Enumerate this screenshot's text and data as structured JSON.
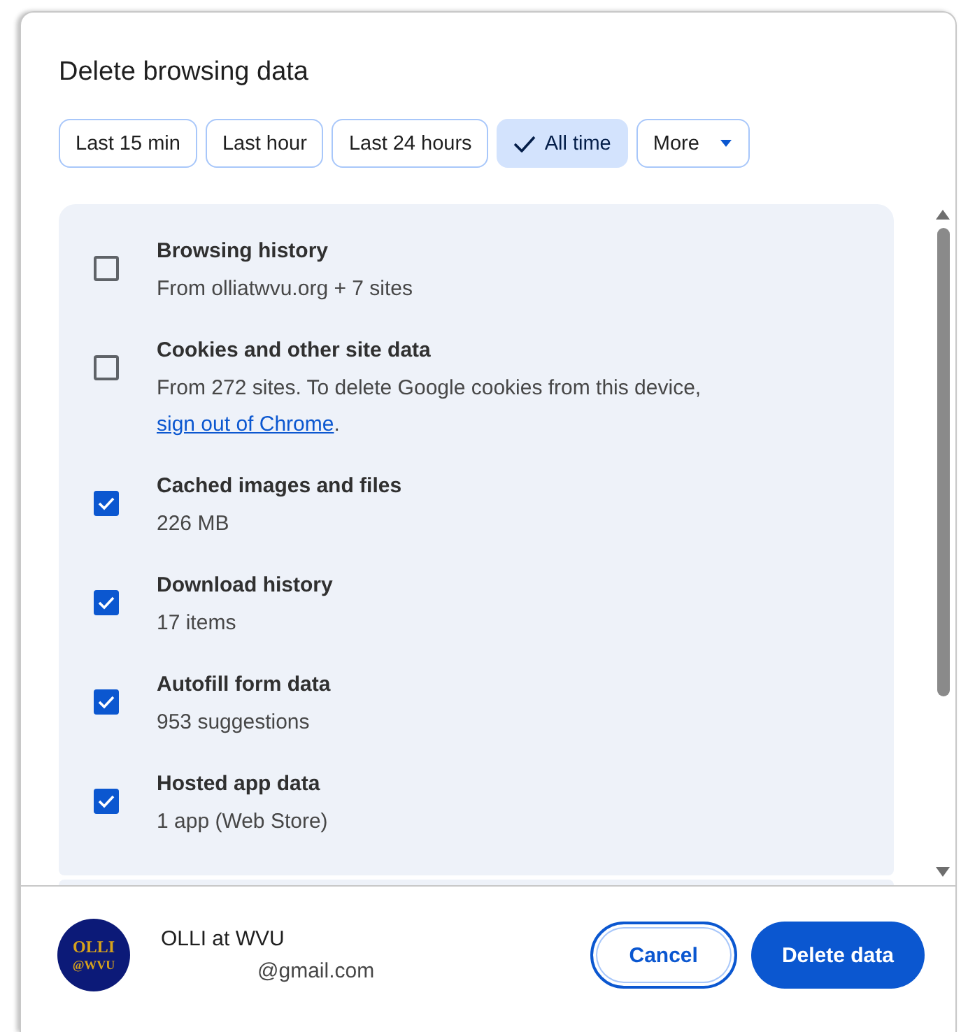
{
  "dialog": {
    "title": "Delete browsing data"
  },
  "time_ranges": [
    {
      "label": "Last 15 min",
      "selected": false
    },
    {
      "label": "Last hour",
      "selected": false
    },
    {
      "label": "Last 24 hours",
      "selected": false
    },
    {
      "label": "All time",
      "selected": true
    },
    {
      "label": "More",
      "selected": false,
      "kind": "dropdown"
    }
  ],
  "items": [
    {
      "title": "Browsing history",
      "description": "From olliatwvu.org + 7 sites",
      "checked": false
    },
    {
      "title": "Cookies and other site data",
      "description": "From 272 sites. To delete Google cookies from this device,",
      "link": "sign out of Chrome",
      "after_link": ".",
      "checked": false
    },
    {
      "title": "Cached images and files",
      "description": "226 MB",
      "checked": true
    },
    {
      "title": "Download history",
      "description": "17 items",
      "checked": true
    },
    {
      "title": "Autofill form data",
      "description": "953 suggestions",
      "checked": true
    },
    {
      "title": "Hosted app data",
      "description": "1 app (Web Store)",
      "checked": true
    }
  ],
  "account": {
    "avatar_lines": [
      "OLLI",
      "@WVU"
    ],
    "name": "OLLI at WVU",
    "email": "@gmail.com"
  },
  "buttons": [
    {
      "label": "Cancel",
      "kind": "secondary"
    },
    {
      "label": "Delete data",
      "kind": "primary"
    }
  ]
}
